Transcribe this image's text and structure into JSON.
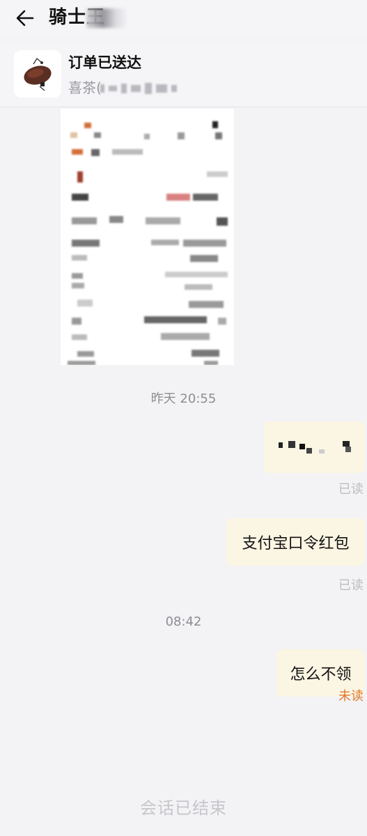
{
  "header": {
    "back_icon": "back-arrow-icon",
    "title": "骑士王"
  },
  "order": {
    "status": "订单已送达",
    "shop_prefix": "喜茶(",
    "thumb_icon": "cake-product-icon"
  },
  "messages": {
    "time1": "昨天 20:55",
    "time2": "08:42",
    "read1": "已读",
    "bubble2": "支付宝口令红包",
    "read2": "已读",
    "bubble3": "怎么不领",
    "unread": "未读"
  },
  "footer": {
    "ended": "会话已结束"
  },
  "colors": {
    "bubble_bg": "#fbf5e3",
    "unread": "#e0782c",
    "read": "#bdbdc2",
    "background": "#f3f3f5"
  }
}
